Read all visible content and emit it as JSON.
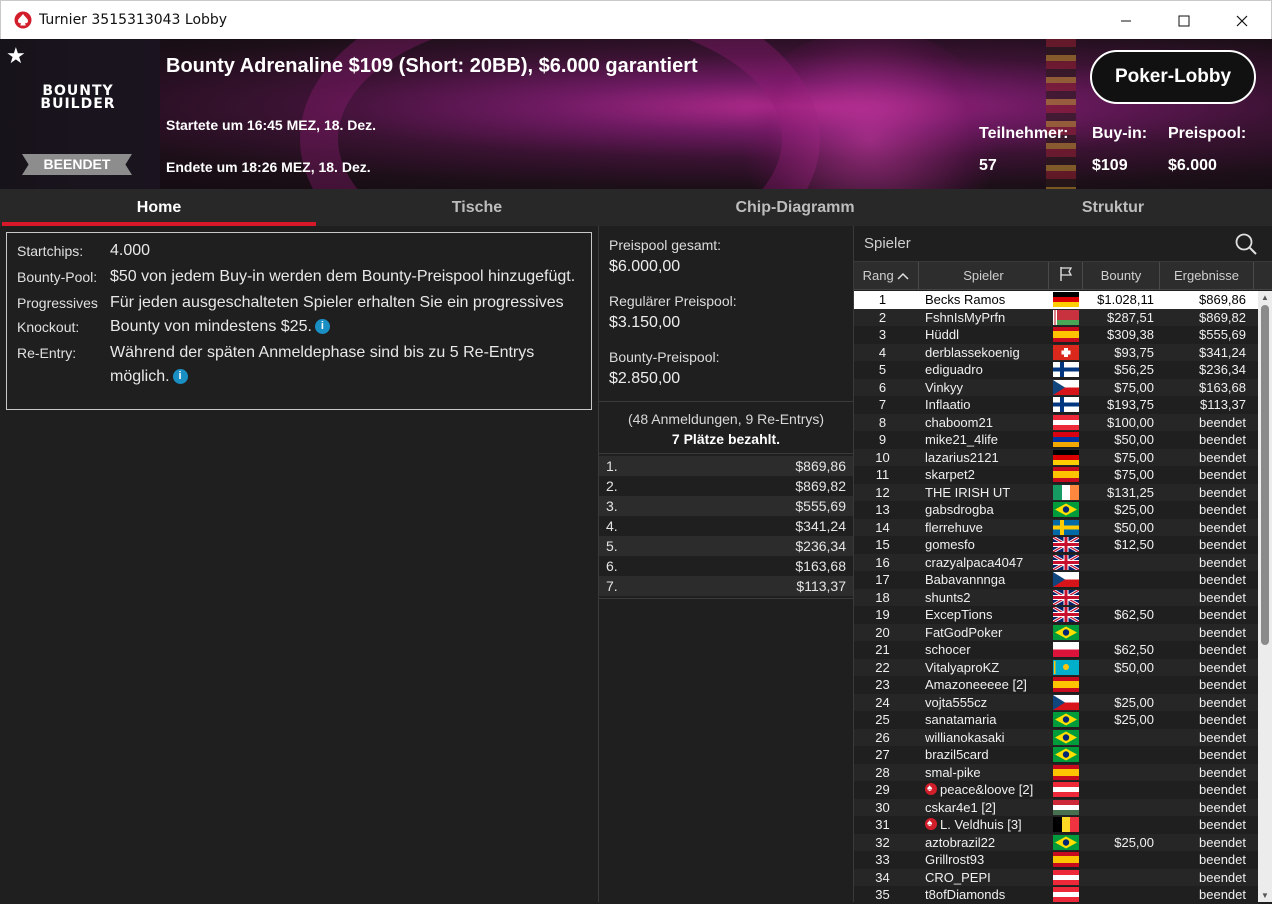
{
  "window": {
    "title": "Turnier 3515313043 Lobby",
    "minimize": "—",
    "maximize": "☐",
    "close": "✕"
  },
  "banner": {
    "logo_line1": "BOUNTY",
    "logo_line2": "BUILDER",
    "status": "BEENDET",
    "tournament_name": "Bounty Adrenaline $109 (Short: 20BB), $6.000 garantiert",
    "started": "Startete um 16:45 MEZ, 18. Dez.",
    "ended": "Endete um 18:26 MEZ, 18. Dez.",
    "lobby_button": "Poker-Lobby",
    "participants_label": "Teilnehmer:",
    "participants_value": "57",
    "buyin_label": "Buy-in:",
    "buyin_value": "$109",
    "prizepool_label": "Preispool:",
    "prizepool_value": "$6.000"
  },
  "tabs": [
    "Home",
    "Tische",
    "Chip-Diagramm",
    "Struktur"
  ],
  "info": {
    "startchips_label": "Startchips:",
    "startchips_value": "4.000",
    "bountypool_label": "Bounty-Pool:",
    "bountypool_value": "$50 von jedem Buy-in werden dem Bounty-Preispool hinzugefügt.",
    "pko_label": "Progressives Knockout:",
    "pko_value": "Für jeden ausgeschalteten Spieler erhalten Sie ein progressives Bounty von mindestens $25.",
    "reentry_label": "Re-Entry:",
    "reentry_value": "Während der späten Anmeldephase sind bis zu 5 Re-Entrys möglich.",
    "info_icon": "i"
  },
  "pool": {
    "total_label": "Preispool gesamt:",
    "total_value": "$6.000,00",
    "regular_label": "Regulärer Preispool:",
    "regular_value": "$3.150,00",
    "bounty_label": "Bounty-Preispool:",
    "bounty_value": "$2.850,00",
    "entries_text": "(48 Anmeldungen, 9 Re-Entrys)",
    "paid_text": "7 Plätze bezahlt."
  },
  "payouts": [
    {
      "place": "1.",
      "amount": "$869,86"
    },
    {
      "place": "2.",
      "amount": "$869,82"
    },
    {
      "place": "3.",
      "amount": "$555,69"
    },
    {
      "place": "4.",
      "amount": "$341,24"
    },
    {
      "place": "5.",
      "amount": "$236,34"
    },
    {
      "place": "6.",
      "amount": "$163,68"
    },
    {
      "place": "7.",
      "amount": "$113,37"
    }
  ],
  "players_panel": {
    "search_placeholder": "Spieler",
    "col_rank": "Rang",
    "col_player": "Spieler",
    "col_bounty": "Bounty",
    "col_results": "Ergebnisse"
  },
  "players": [
    {
      "rank": "1",
      "name": "Becks Ramos",
      "flag": "de",
      "bounty": "$1.028,11",
      "result": "$869,86"
    },
    {
      "rank": "2",
      "name": "FshnIsMyPrfn",
      "flag": "by",
      "bounty": "$287,51",
      "result": "$869,82"
    },
    {
      "rank": "3",
      "name": "Hüddl",
      "flag": "es",
      "bounty": "$309,38",
      "result": "$555,69"
    },
    {
      "rank": "4",
      "name": "derblassekoenig",
      "flag": "ch",
      "bounty": "$93,75",
      "result": "$341,24"
    },
    {
      "rank": "5",
      "name": "ediguadro",
      "flag": "fi",
      "bounty": "$56,25",
      "result": "$236,34"
    },
    {
      "rank": "6",
      "name": "Vinkyy",
      "flag": "cz",
      "bounty": "$75,00",
      "result": "$163,68"
    },
    {
      "rank": "7",
      "name": "Inflaatio",
      "flag": "fi",
      "bounty": "$193,75",
      "result": "$113,37"
    },
    {
      "rank": "8",
      "name": "chaboom21",
      "flag": "at",
      "bounty": "$100,00",
      "result": "beendet"
    },
    {
      "rank": "9",
      "name": "mike21_4life",
      "flag": "am",
      "bounty": "$50,00",
      "result": "beendet"
    },
    {
      "rank": "10",
      "name": "lazarius2121",
      "flag": "de",
      "bounty": "$75,00",
      "result": "beendet"
    },
    {
      "rank": "11",
      "name": "skarpet2",
      "flag": "es",
      "bounty": "$75,00",
      "result": "beendet"
    },
    {
      "rank": "12",
      "name": "THE IRISH UT",
      "flag": "ie",
      "bounty": "$131,25",
      "result": "beendet"
    },
    {
      "rank": "13",
      "name": "gabsdrogba",
      "flag": "br",
      "bounty": "$25,00",
      "result": "beendet"
    },
    {
      "rank": "14",
      "name": "flerrehuve",
      "flag": "se",
      "bounty": "$50,00",
      "result": "beendet"
    },
    {
      "rank": "15",
      "name": "gomesfo",
      "flag": "gb",
      "bounty": "$12,50",
      "result": "beendet"
    },
    {
      "rank": "16",
      "name": "crazyalpaca4047",
      "flag": "gb",
      "bounty": "",
      "result": "beendet"
    },
    {
      "rank": "17",
      "name": "Babavannnga",
      "flag": "cz",
      "bounty": "",
      "result": "beendet"
    },
    {
      "rank": "18",
      "name": "shunts2",
      "flag": "gb",
      "bounty": "",
      "result": "beendet"
    },
    {
      "rank": "19",
      "name": "ExcepTions",
      "flag": "gb",
      "bounty": "$62,50",
      "result": "beendet"
    },
    {
      "rank": "20",
      "name": "FatGodPoker",
      "flag": "br",
      "bounty": "",
      "result": "beendet"
    },
    {
      "rank": "21",
      "name": "schocer",
      "flag": "pl",
      "bounty": "$62,50",
      "result": "beendet"
    },
    {
      "rank": "22",
      "name": "VitalyaproKZ",
      "flag": "kz",
      "bounty": "$50,00",
      "result": "beendet"
    },
    {
      "rank": "23",
      "name": "Amazoneeeee [2]",
      "flag": "es",
      "bounty": "",
      "result": "beendet"
    },
    {
      "rank": "24",
      "name": "vojta555cz",
      "flag": "cz",
      "bounty": "$25,00",
      "result": "beendet"
    },
    {
      "rank": "25",
      "name": "sanatamaria",
      "flag": "br",
      "bounty": "$25,00",
      "result": "beendet"
    },
    {
      "rank": "26",
      "name": "willianokasaki",
      "flag": "br",
      "bounty": "",
      "result": "beendet"
    },
    {
      "rank": "27",
      "name": "brazil5card",
      "flag": "br",
      "bounty": "",
      "result": "beendet"
    },
    {
      "rank": "28",
      "name": "smal-pike",
      "flag": "es",
      "bounty": "",
      "result": "beendet"
    },
    {
      "rank": "29",
      "name": "peace&loove [2]",
      "flag": "at",
      "bounty": "",
      "result": "beendet",
      "ps": true
    },
    {
      "rank": "30",
      "name": "cskar4e1 [2]",
      "flag": "hu",
      "bounty": "",
      "result": "beendet"
    },
    {
      "rank": "31",
      "name": "L. Veldhuis [3]",
      "flag": "be",
      "bounty": "",
      "result": "beendet",
      "ps": true
    },
    {
      "rank": "32",
      "name": "aztobrazil22",
      "flag": "br",
      "bounty": "$25,00",
      "result": "beendet"
    },
    {
      "rank": "33",
      "name": "Grillrost93",
      "flag": "es",
      "bounty": "",
      "result": "beendet"
    },
    {
      "rank": "34",
      "name": "CRO_PEPI",
      "flag": "at",
      "bounty": "",
      "result": "beendet"
    },
    {
      "rank": "35",
      "name": "t8ofDiamonds",
      "flag": "at",
      "bounty": "",
      "result": "beendet"
    }
  ],
  "colors": {
    "accent_red": "#d6192a",
    "info_blue": "#1a8fc4"
  }
}
